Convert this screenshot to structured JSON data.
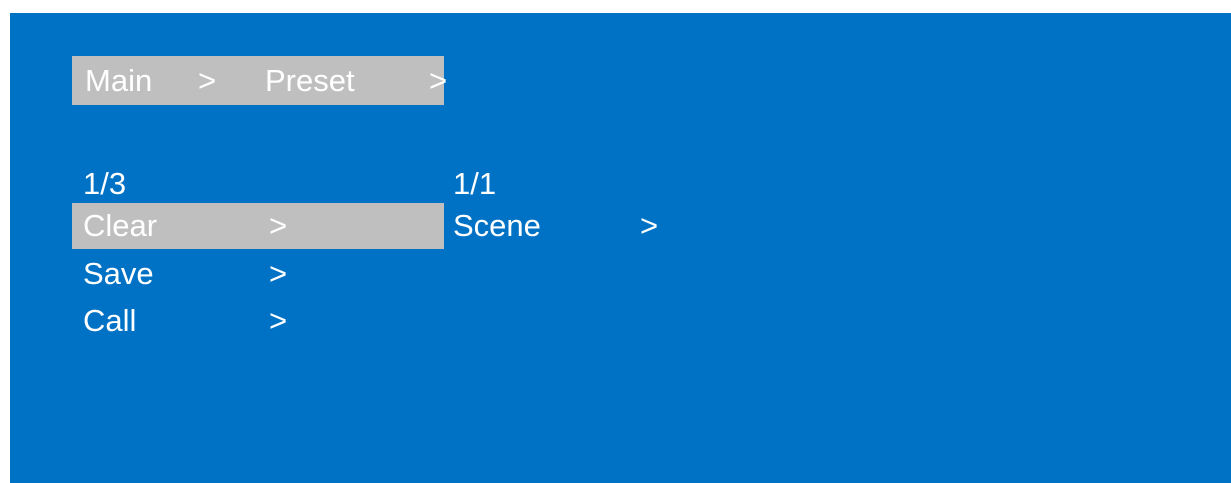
{
  "breadcrumb": {
    "items": [
      "Main",
      "Preset"
    ],
    "separator": ">"
  },
  "left_menu": {
    "page_indicator": "1/3",
    "items": [
      {
        "label": "Clear",
        "arrow": ">"
      },
      {
        "label": "Save",
        "arrow": ">"
      },
      {
        "label": "Call",
        "arrow": ">"
      }
    ],
    "selected": "Clear"
  },
  "right_menu": {
    "page_indicator": "1/1",
    "items": [
      {
        "label": "Scene",
        "arrow": ">"
      }
    ]
  },
  "colors": {
    "background": "#0072c6",
    "highlight": "#bfbfbf",
    "text": "#ffffff"
  }
}
